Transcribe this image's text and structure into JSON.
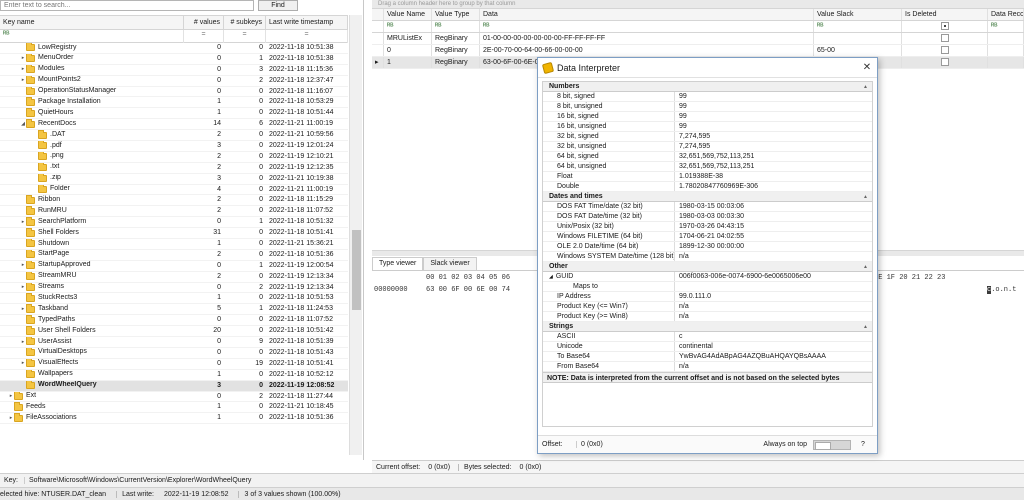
{
  "tree": {
    "search_placeholder": "Enter text to search...",
    "find_label": "Find",
    "headers": {
      "key_name": "Key name",
      "values": "# values",
      "subkeys": "# subkeys",
      "timestamp": "Last write timestamp"
    },
    "filter_eq": "=",
    "rows": [
      {
        "name": "LowRegistry",
        "values": "0",
        "subkeys": "0",
        "ts": "2022-11-18 10:51:38",
        "exp": "",
        "indent": 1
      },
      {
        "name": "MenuOrder",
        "values": "0",
        "subkeys": "1",
        "ts": "2022-11-18 10:51:38",
        "exp": "▸",
        "indent": 1
      },
      {
        "name": "Modules",
        "values": "0",
        "subkeys": "3",
        "ts": "2022-11-18 11:15:36",
        "exp": "▸",
        "indent": 1
      },
      {
        "name": "MountPoints2",
        "values": "0",
        "subkeys": "2",
        "ts": "2022-11-18 12:37:47",
        "exp": "▸",
        "indent": 1
      },
      {
        "name": "OperationStatusManager",
        "values": "0",
        "subkeys": "0",
        "ts": "2022-11-18 11:16:07",
        "exp": "",
        "indent": 1
      },
      {
        "name": "Package Installation",
        "values": "1",
        "subkeys": "0",
        "ts": "2022-11-18 10:53:29",
        "exp": "",
        "indent": 1
      },
      {
        "name": "QuietHours",
        "values": "1",
        "subkeys": "0",
        "ts": "2022-11-18 10:51:44",
        "exp": "",
        "indent": 1
      },
      {
        "name": "RecentDocs",
        "values": "14",
        "subkeys": "6",
        "ts": "2022-11-21 11:00:19",
        "exp": "◢",
        "indent": 1
      },
      {
        "name": ".DAT",
        "values": "2",
        "subkeys": "0",
        "ts": "2022-11-21 10:59:56",
        "exp": "",
        "indent": 2
      },
      {
        "name": ".pdf",
        "values": "3",
        "subkeys": "0",
        "ts": "2022-11-19 12:01:24",
        "exp": "",
        "indent": 2
      },
      {
        "name": ".png",
        "values": "2",
        "subkeys": "0",
        "ts": "2022-11-19 12:10:21",
        "exp": "",
        "indent": 2
      },
      {
        "name": ".txt",
        "values": "2",
        "subkeys": "0",
        "ts": "2022-11-19 12:12:35",
        "exp": "",
        "indent": 2
      },
      {
        "name": ".zip",
        "values": "3",
        "subkeys": "0",
        "ts": "2022-11-21 10:19:38",
        "exp": "",
        "indent": 2
      },
      {
        "name": "Folder",
        "values": "4",
        "subkeys": "0",
        "ts": "2022-11-21 11:00:19",
        "exp": "",
        "indent": 2
      },
      {
        "name": "Ribbon",
        "values": "2",
        "subkeys": "0",
        "ts": "2022-11-18 11:15:29",
        "exp": "",
        "indent": 1
      },
      {
        "name": "RunMRU",
        "values": "2",
        "subkeys": "0",
        "ts": "2022-11-18 11:07:52",
        "exp": "",
        "indent": 1
      },
      {
        "name": "SearchPlatform",
        "values": "0",
        "subkeys": "1",
        "ts": "2022-11-18 10:51:32",
        "exp": "▸",
        "indent": 1
      },
      {
        "name": "Shell Folders",
        "values": "31",
        "subkeys": "0",
        "ts": "2022-11-18 10:51:41",
        "exp": "",
        "indent": 1
      },
      {
        "name": "Shutdown",
        "values": "1",
        "subkeys": "0",
        "ts": "2022-11-21 15:36:21",
        "exp": "",
        "indent": 1
      },
      {
        "name": "StartPage",
        "values": "2",
        "subkeys": "0",
        "ts": "2022-11-18 10:51:36",
        "exp": "",
        "indent": 1
      },
      {
        "name": "StartupApproved",
        "values": "0",
        "subkeys": "1",
        "ts": "2022-11-19 12:00:54",
        "exp": "▸",
        "indent": 1
      },
      {
        "name": "StreamMRU",
        "values": "2",
        "subkeys": "0",
        "ts": "2022-11-19 12:13:34",
        "exp": "",
        "indent": 1
      },
      {
        "name": "Streams",
        "values": "0",
        "subkeys": "2",
        "ts": "2022-11-19 12:13:34",
        "exp": "▸",
        "indent": 1
      },
      {
        "name": "StuckRects3",
        "values": "1",
        "subkeys": "0",
        "ts": "2022-11-18 10:51:53",
        "exp": "",
        "indent": 1
      },
      {
        "name": "Taskband",
        "values": "5",
        "subkeys": "1",
        "ts": "2022-11-18 11:24:53",
        "exp": "▸",
        "indent": 1
      },
      {
        "name": "TypedPaths",
        "values": "0",
        "subkeys": "0",
        "ts": "2022-11-18 11:07:52",
        "exp": "",
        "indent": 1
      },
      {
        "name": "User Shell Folders",
        "values": "20",
        "subkeys": "0",
        "ts": "2022-11-18 10:51:42",
        "exp": "",
        "indent": 1
      },
      {
        "name": "UserAssist",
        "values": "0",
        "subkeys": "9",
        "ts": "2022-11-18 10:51:39",
        "exp": "▸",
        "indent": 1
      },
      {
        "name": "VirtualDesktops",
        "values": "0",
        "subkeys": "0",
        "ts": "2022-11-18 10:51:43",
        "exp": "",
        "indent": 1
      },
      {
        "name": "VisualEffects",
        "values": "0",
        "subkeys": "19",
        "ts": "2022-11-18 10:51:41",
        "exp": "▸",
        "indent": 1
      },
      {
        "name": "Wallpapers",
        "values": "1",
        "subkeys": "0",
        "ts": "2022-11-18 10:52:12",
        "exp": "",
        "indent": 1
      },
      {
        "name": "WordWheelQuery",
        "values": "3",
        "subkeys": "0",
        "ts": "2022-11-19 12:08:52",
        "exp": "",
        "indent": 1,
        "selected": true
      },
      {
        "name": "Ext",
        "values": "0",
        "subkeys": "2",
        "ts": "2022-11-18 11:27:44",
        "exp": "▸",
        "indent": 0
      },
      {
        "name": "Feeds",
        "values": "1",
        "subkeys": "0",
        "ts": "2022-11-21 10:18:45",
        "exp": "",
        "indent": 0
      },
      {
        "name": "FileAssociations",
        "values": "1",
        "subkeys": "0",
        "ts": "2022-11-18 10:51:36",
        "exp": "▸",
        "indent": 0
      }
    ]
  },
  "values_grid": {
    "group_hint": "Drag a column header here to group by that column",
    "headers": {
      "name": "Value Name",
      "type": "Value Type",
      "data": "Data",
      "slack": "Value Slack",
      "deleted": "Is Deleted",
      "record": "Data Record"
    },
    "rows": [
      {
        "marker": "",
        "name": "MRUListEx",
        "type": "RegBinary",
        "data": "01-00-00-00-00-00-00-00-FF-FF-FF-FF",
        "slack": ""
      },
      {
        "marker": "",
        "name": "0",
        "type": "RegBinary",
        "data": "2E-00-70-00-64-00-66-00-00-00",
        "slack": "65-00"
      },
      {
        "marker": "▸",
        "name": "1",
        "type": "RegBinary",
        "data": "63-00-6F-00-6E-00",
        "slack": "",
        "selected": true
      }
    ]
  },
  "hex_viewer": {
    "tabs": [
      "Type viewer",
      "Slack viewer"
    ],
    "cols_start": "00 01 02 03 04 05 06",
    "cols_end": "1E 1F 20 21 22 23",
    "offset": "00000000",
    "bytes": "63 00 6F 00 6E 00 74",
    "ascii_cursor": "c",
    "ascii_rest": ".o.n.t"
  },
  "hex_status": {
    "current_offset_label": "Current offset:",
    "current_offset_value": "0 (0x0)",
    "bytes_selected_label": "Bytes selected:",
    "bytes_selected_value": "0 (0x0)"
  },
  "key_bar": {
    "label": "Key:",
    "path": "Software\\Microsoft\\Windows\\CurrentVersion\\Explorer\\WordWheelQuery"
  },
  "status_bar": {
    "hive": "elected hive: NTUSER.DAT_clean",
    "last_write_label": "Last write:",
    "last_write_value": "2022-11-19 12:08:52",
    "shown": "3 of 3 values shown (100.00%)"
  },
  "data_interpreter": {
    "title": "Data Interpreter",
    "close": "✕",
    "sections": [
      {
        "title": "Numbers",
        "rows": [
          {
            "label": "8 bit, signed",
            "value": "99"
          },
          {
            "label": "8 bit, unsigned",
            "value": "99"
          },
          {
            "label": "16 bit, signed",
            "value": "99"
          },
          {
            "label": "16 bit, unsigned",
            "value": "99"
          },
          {
            "label": "32 bit, signed",
            "value": "7,274,595"
          },
          {
            "label": "32 bit, unsigned",
            "value": "7,274,595"
          },
          {
            "label": "64 bit, signed",
            "value": "32,651,569,752,113,251"
          },
          {
            "label": "64 bit, unsigned",
            "value": "32,651,569,752,113,251"
          },
          {
            "label": "Float",
            "value": "1.019388E-38"
          },
          {
            "label": "Double",
            "value": "1.78020847760969E-306"
          }
        ]
      },
      {
        "title": "Dates and times",
        "rows": [
          {
            "label": "DOS FAT Time/date (32 bit)",
            "value": "1980-03-15 00:03:06"
          },
          {
            "label": "DOS FAT Date/time (32 bit)",
            "value": "1980-03-03 00:03:30"
          },
          {
            "label": "Unix/Posix (32 bit)",
            "value": "1970-03-26 04:43:15"
          },
          {
            "label": "Windows FILETIME (64 bit)",
            "value": "1704-06-21 04:02:55"
          },
          {
            "label": "OLE 2.0 Date/time (64 bit)",
            "value": "1899-12-30 00:00:00"
          },
          {
            "label": "Windows SYSTEM Date/time (128 bit)",
            "value": "n/a"
          }
        ]
      },
      {
        "title": "Other",
        "rows": [
          {
            "label": "GUID",
            "value": "006f0063-006e-0074-6900-6e0065006e00",
            "expander": "◢"
          },
          {
            "label": "Maps to",
            "value": "",
            "sub": true
          },
          {
            "label": "IP Address",
            "value": "99.0.111.0"
          },
          {
            "label": "Product Key (<= Win7)",
            "value": "n/a"
          },
          {
            "label": "Product Key (>= Win8)",
            "value": "n/a"
          }
        ]
      },
      {
        "title": "Strings",
        "rows": [
          {
            "label": "ASCII",
            "value": "c"
          },
          {
            "label": "Unicode",
            "value": "continental"
          },
          {
            "label": "To Base64",
            "value": "YwBvAG4AdABpAG4AZQBuAHQAYQBsAAAA"
          },
          {
            "label": "From Base64",
            "value": "n/a"
          }
        ]
      }
    ],
    "note": "NOTE: Data is interpreted from the current offset and is not based on the selected bytes",
    "offset_label": "Offset:",
    "offset_value": "0 (0x0)",
    "always_on_top": "Always on top",
    "help": "?"
  },
  "colors": {
    "folder": "#f4c542",
    "selection": "#e2e2e2",
    "window_border": "#7d9ec4"
  }
}
